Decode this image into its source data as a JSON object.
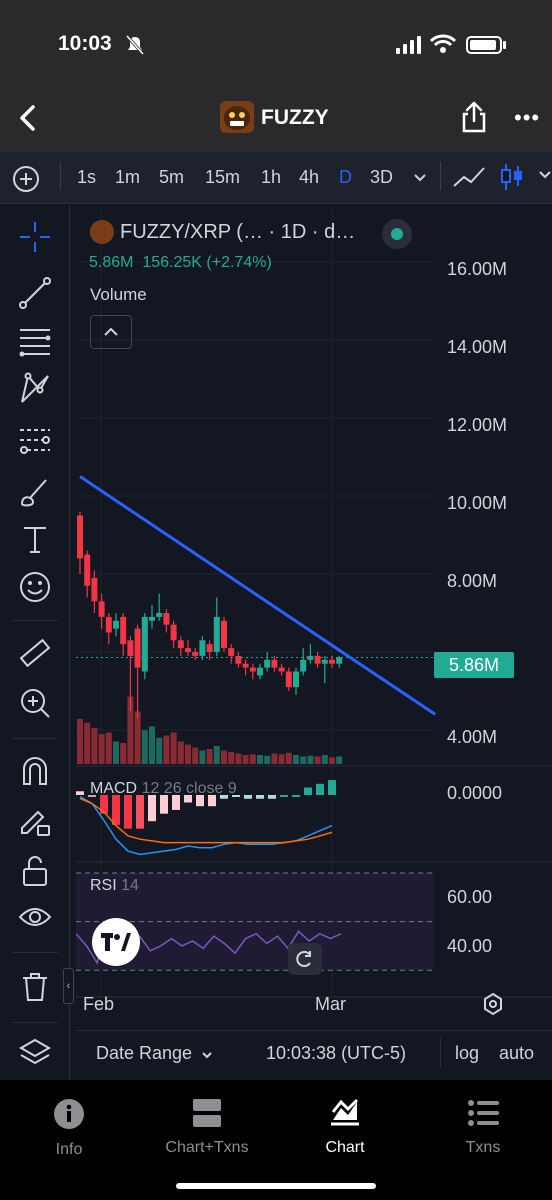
{
  "status_bar": {
    "time": "10:03"
  },
  "header": {
    "title": "FUZZY"
  },
  "intervals": [
    {
      "label": "1s",
      "active": false
    },
    {
      "label": "1m",
      "active": false
    },
    {
      "label": "5m",
      "active": false
    },
    {
      "label": "15m",
      "active": false
    },
    {
      "label": "1h",
      "active": false
    },
    {
      "label": "4h",
      "active": false
    },
    {
      "label": "D",
      "active": true
    },
    {
      "label": "3D",
      "active": false
    }
  ],
  "left_tools": [
    "crosshair-icon",
    "trend-line-icon",
    "fib-retracement-icon",
    "pattern-icon",
    "prediction-icon",
    "brush-icon",
    "text-tool-icon",
    "emoji-icon",
    "ruler-icon",
    "zoom-in-icon",
    "magnet-icon",
    "lock-pencil-icon",
    "unlock-icon",
    "eye-icon",
    "trash-icon",
    "layers-icon"
  ],
  "chart": {
    "symbol": "FUZZY/XRP (… · 1D · d…",
    "ohlc_text": "5.86M  156.25K (+2.74%)",
    "volume_label": "Volume",
    "macd_name": "MACD",
    "macd_params": "12 26 close 9",
    "rsi_name": "RSI",
    "rsi_params": "14",
    "last_price_label": "5.86M",
    "y_axis_labels": [
      "16.00M",
      "14.00M",
      "12.00M",
      "10.00M",
      "8.00M",
      "4.00M"
    ],
    "macd_axis_label": "0.0000",
    "rsi_axis_labels": [
      "60.00",
      "40.00"
    ],
    "x_axis_labels": [
      "Feb",
      "Mar"
    ],
    "colors": {
      "up": "#22ab94",
      "down": "#f23645",
      "trendline": "#2962ff",
      "accent": "#2962ff"
    }
  },
  "chart_data": {
    "type": "candlestick",
    "title": "FUZZY/XRP (… · 1D · d…",
    "y_range": [
      3.2,
      17.0
    ],
    "last_price": 5.86,
    "change": "156.25K (+2.74%)",
    "x_ticks": [
      "Feb",
      "Mar"
    ],
    "candles": [
      {
        "o": 9.5,
        "c": 8.4,
        "h": 9.6,
        "l": 8.0
      },
      {
        "o": 8.5,
        "c": 7.7,
        "h": 8.6,
        "l": 7.4
      },
      {
        "o": 7.9,
        "c": 7.3,
        "h": 8.1,
        "l": 7.0
      },
      {
        "o": 7.3,
        "c": 6.9,
        "h": 7.5,
        "l": 6.6
      },
      {
        "o": 6.9,
        "c": 6.5,
        "h": 7.0,
        "l": 6.2
      },
      {
        "o": 6.6,
        "c": 6.8,
        "h": 7.0,
        "l": 6.4
      },
      {
        "o": 6.9,
        "c": 6.2,
        "h": 7.0,
        "l": 5.9
      },
      {
        "o": 6.3,
        "c": 5.9,
        "h": 6.4,
        "l": 4.5
      },
      {
        "o": 6.6,
        "c": 5.6,
        "h": 6.7,
        "l": 4.3
      },
      {
        "o": 5.5,
        "c": 6.9,
        "h": 7.0,
        "l": 5.3
      },
      {
        "o": 6.8,
        "c": 6.9,
        "h": 7.2,
        "l": 6.6
      },
      {
        "o": 6.9,
        "c": 7.0,
        "h": 7.5,
        "l": 6.8
      },
      {
        "o": 7.0,
        "c": 6.7,
        "h": 7.1,
        "l": 6.5
      },
      {
        "o": 6.7,
        "c": 6.3,
        "h": 6.8,
        "l": 6.1
      },
      {
        "o": 6.3,
        "c": 6.1,
        "h": 6.4,
        "l": 5.9
      },
      {
        "o": 6.1,
        "c": 6.0,
        "h": 6.3,
        "l": 5.9
      },
      {
        "o": 6.0,
        "c": 5.9,
        "h": 6.1,
        "l": 5.8
      },
      {
        "o": 5.9,
        "c": 6.3,
        "h": 6.4,
        "l": 5.8
      },
      {
        "o": 6.2,
        "c": 6.0,
        "h": 6.3,
        "l": 5.8
      },
      {
        "o": 6.0,
        "c": 6.9,
        "h": 7.4,
        "l": 5.9
      },
      {
        "o": 6.8,
        "c": 6.1,
        "h": 6.9,
        "l": 6.0
      },
      {
        "o": 6.1,
        "c": 5.9,
        "h": 6.2,
        "l": 5.7
      },
      {
        "o": 5.9,
        "c": 5.7,
        "h": 6.0,
        "l": 5.6
      },
      {
        "o": 5.7,
        "c": 5.6,
        "h": 5.8,
        "l": 5.4
      },
      {
        "o": 5.6,
        "c": 5.5,
        "h": 5.7,
        "l": 5.3
      },
      {
        "o": 5.4,
        "c": 5.6,
        "h": 5.7,
        "l": 5.3
      },
      {
        "o": 5.6,
        "c": 5.8,
        "h": 6.0,
        "l": 5.5
      },
      {
        "o": 5.8,
        "c": 5.6,
        "h": 5.9,
        "l": 5.5
      },
      {
        "o": 5.6,
        "c": 5.5,
        "h": 5.7,
        "l": 5.4
      },
      {
        "o": 5.5,
        "c": 5.1,
        "h": 5.6,
        "l": 5.0
      },
      {
        "o": 5.1,
        "c": 5.5,
        "h": 5.6,
        "l": 4.9
      },
      {
        "o": 5.5,
        "c": 5.8,
        "h": 6.1,
        "l": 5.4
      },
      {
        "o": 5.8,
        "c": 5.9,
        "h": 6.2,
        "l": 5.7
      },
      {
        "o": 5.9,
        "c": 5.7,
        "h": 6.0,
        "l": 5.6
      },
      {
        "o": 5.7,
        "c": 5.8,
        "h": 5.9,
        "l": 5.2
      },
      {
        "o": 5.8,
        "c": 5.7,
        "h": 5.9,
        "l": 5.6
      },
      {
        "o": 5.7,
        "c": 5.86,
        "h": 5.9,
        "l": 5.6
      }
    ],
    "volume": [
      60,
      55,
      48,
      40,
      42,
      30,
      28,
      90,
      70,
      45,
      50,
      35,
      38,
      42,
      30,
      26,
      22,
      18,
      20,
      24,
      18,
      16,
      14,
      12,
      13,
      12,
      11,
      14,
      13,
      15,
      12,
      10,
      11,
      10,
      12,
      9,
      10
    ],
    "volume_up": [
      false,
      false,
      false,
      false,
      false,
      true,
      false,
      false,
      false,
      true,
      true,
      true,
      false,
      false,
      false,
      false,
      false,
      true,
      false,
      true,
      false,
      false,
      false,
      false,
      false,
      true,
      true,
      false,
      false,
      false,
      true,
      true,
      true,
      false,
      true,
      false,
      true
    ],
    "trendline": [
      {
        "x": 0,
        "y": 10.5
      },
      {
        "x": 46,
        "y": 4.4
      }
    ],
    "macd": {
      "macd_line": [
        -0.1,
        -0.5,
        -1.5,
        -2.6,
        -3.3,
        -3.5,
        -3.4,
        -3.3,
        -3.2,
        -3.0,
        -3.1,
        -3.1,
        -2.9,
        -2.8,
        -2.9,
        -2.9,
        -2.9,
        -2.8,
        -2.7,
        -2.4,
        -2.1,
        -1.8
      ],
      "signal_line": [
        -0.2,
        -0.5,
        -1.0,
        -1.8,
        -2.4,
        -2.6,
        -2.7,
        -2.8,
        -2.8,
        -2.8,
        -2.8,
        -2.8,
        -2.8,
        -2.8,
        -2.8,
        -2.8,
        -2.8,
        -2.8,
        -2.7,
        -2.6,
        -2.4,
        -2.2
      ]
    },
    "rsi": [
      45,
      40,
      33,
      50,
      42,
      46,
      44,
      38,
      40,
      43,
      40,
      42,
      39,
      44,
      41,
      37,
      43,
      45,
      41,
      44,
      39,
      46,
      42,
      45,
      43,
      45
    ]
  },
  "bottom_bar": {
    "date_range": "Date Range",
    "clock": "10:03:38 (UTC-5)",
    "log": "log",
    "auto": "auto"
  },
  "tabs": [
    {
      "label": "Info",
      "icon": "info-icon",
      "active": false
    },
    {
      "label": "Chart+Txns",
      "icon": "split-view-icon",
      "active": false
    },
    {
      "label": "Chart",
      "icon": "chart-icon",
      "active": true
    },
    {
      "label": "Txns",
      "icon": "list-icon",
      "active": false
    }
  ]
}
